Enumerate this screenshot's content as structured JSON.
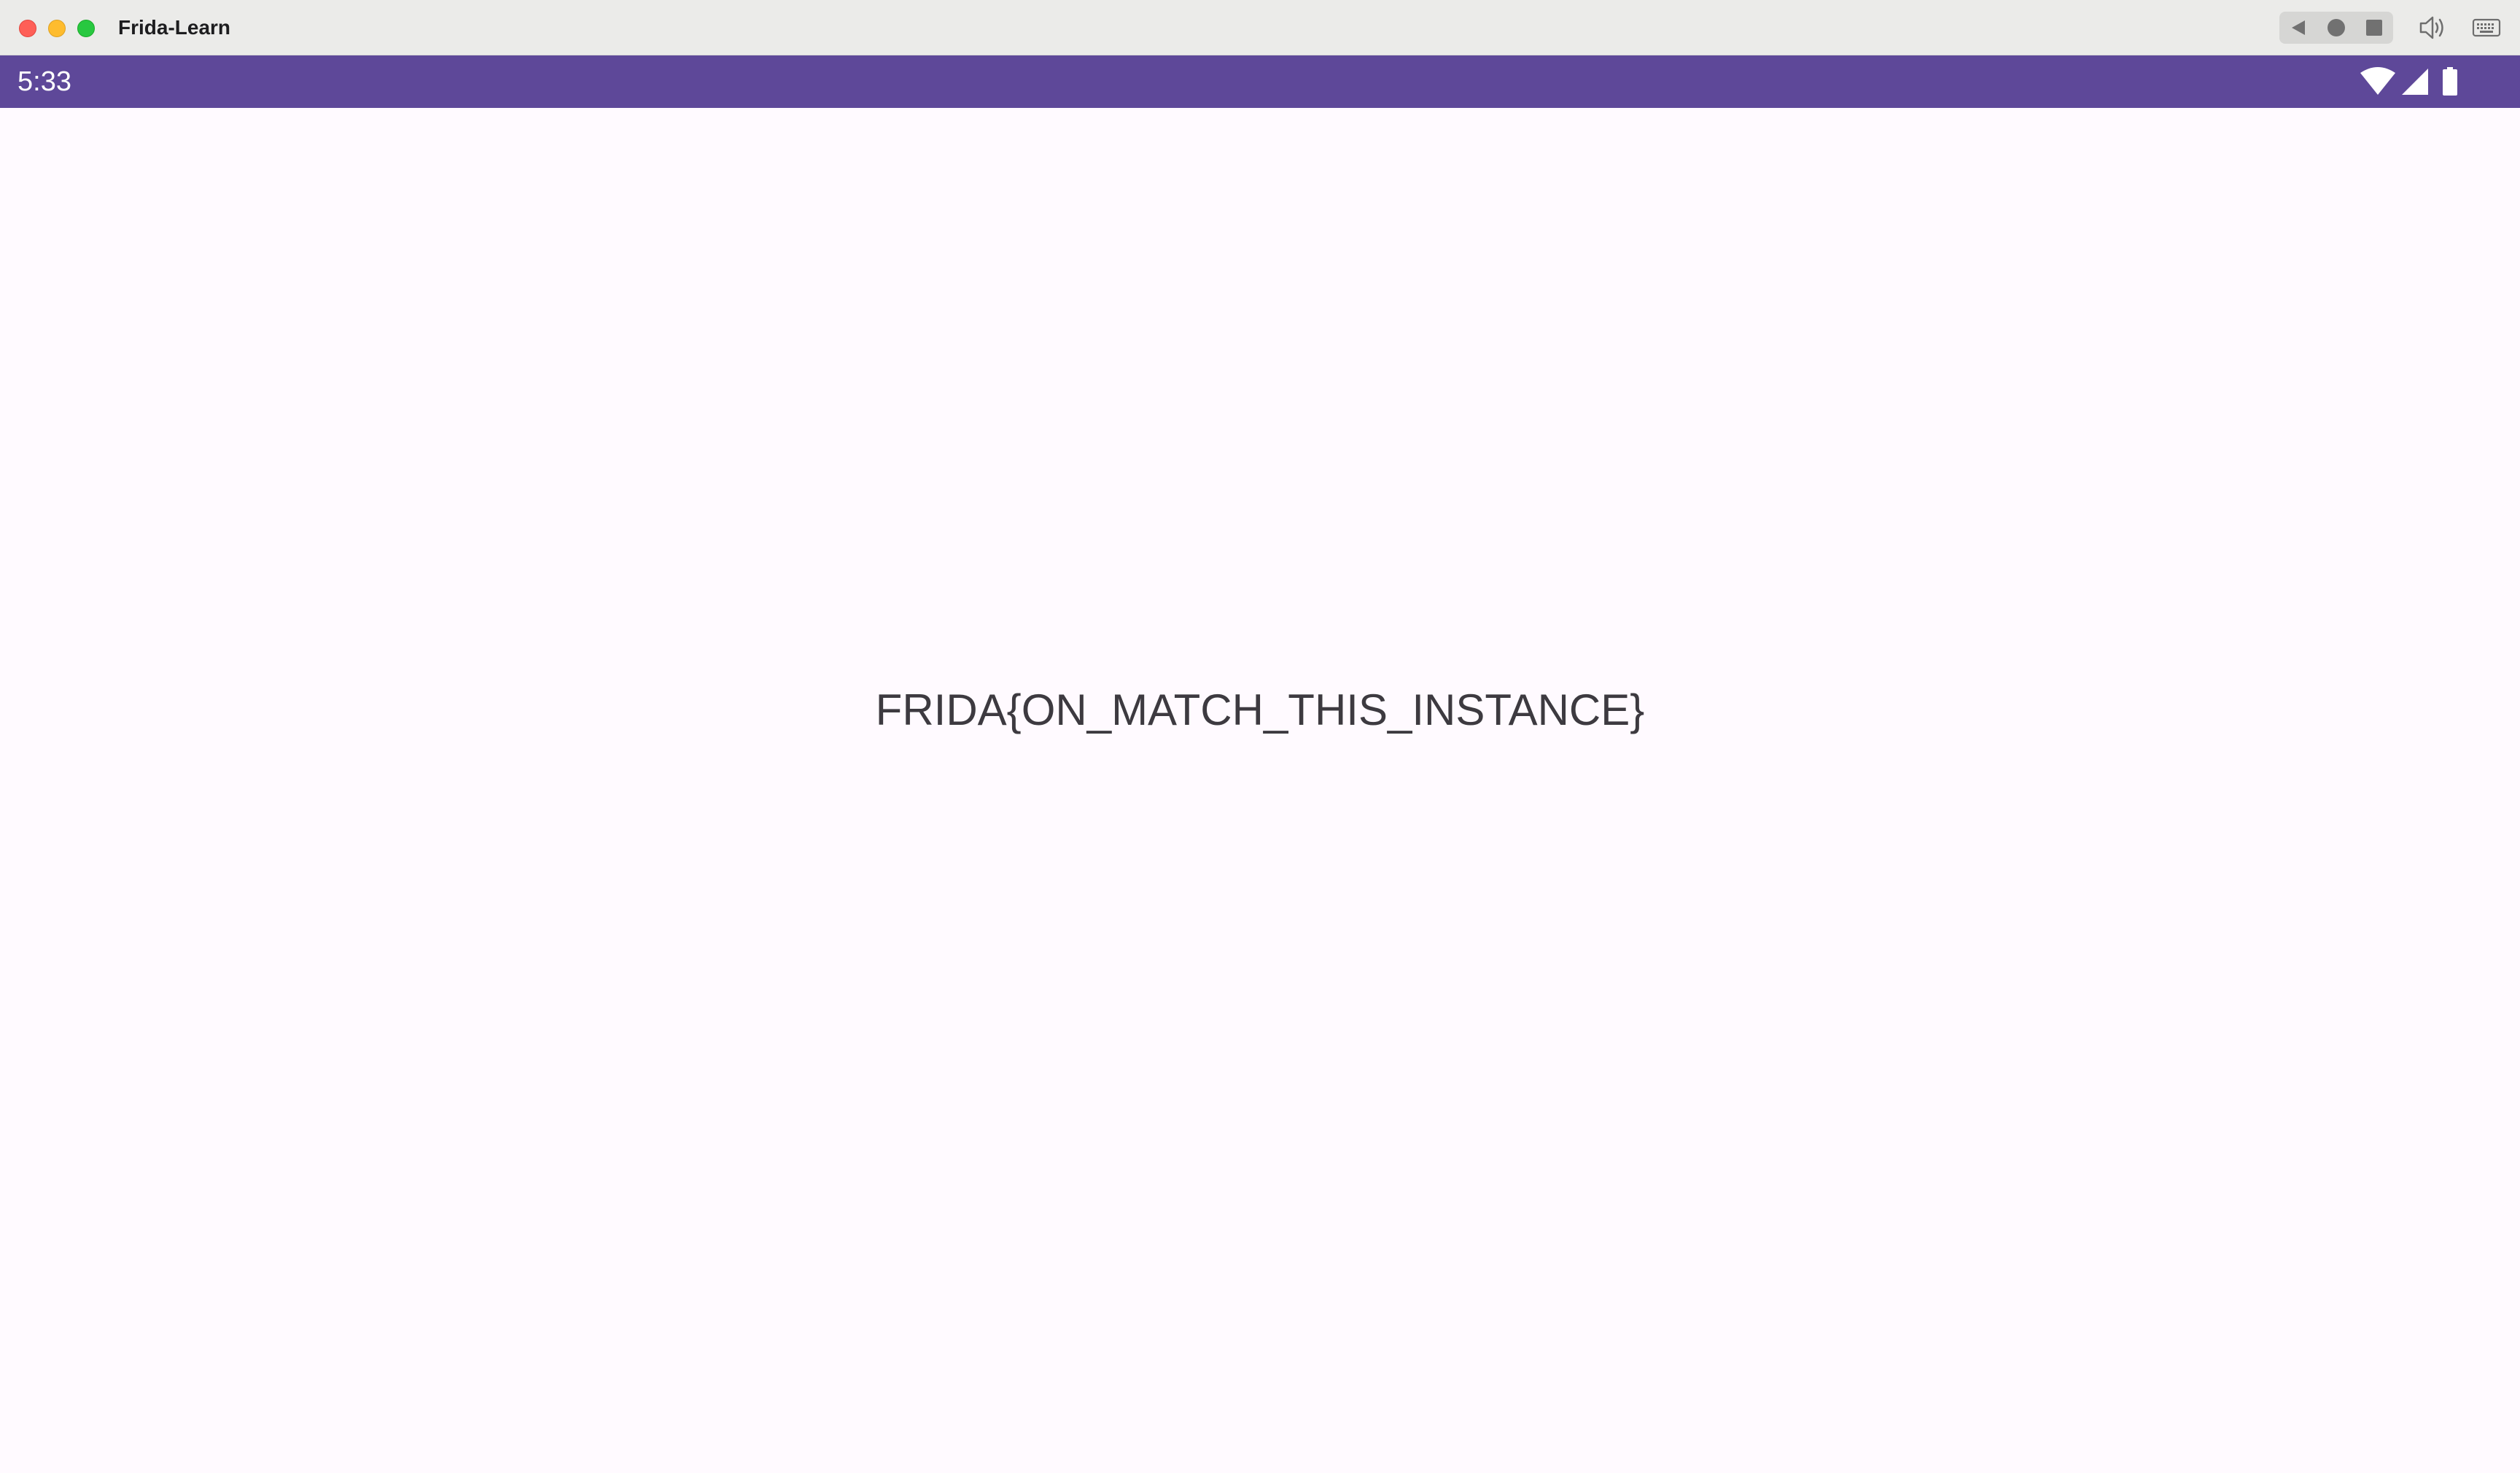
{
  "window": {
    "title": "Frida-Learn"
  },
  "toolbar": {
    "back_icon": "triangle-back-icon",
    "home_icon": "circle-home-icon",
    "overview_icon": "square-overview-icon",
    "volume_icon": "volume-icon",
    "keyboard_icon": "keyboard-icon"
  },
  "status_bar": {
    "time": "5:33",
    "icons": [
      "wifi-icon",
      "cellular-signal-icon",
      "battery-icon"
    ],
    "color": "#5e4899"
  },
  "main": {
    "message": "FRIDA{ON_MATCH_THIS_INSTANCE}"
  }
}
